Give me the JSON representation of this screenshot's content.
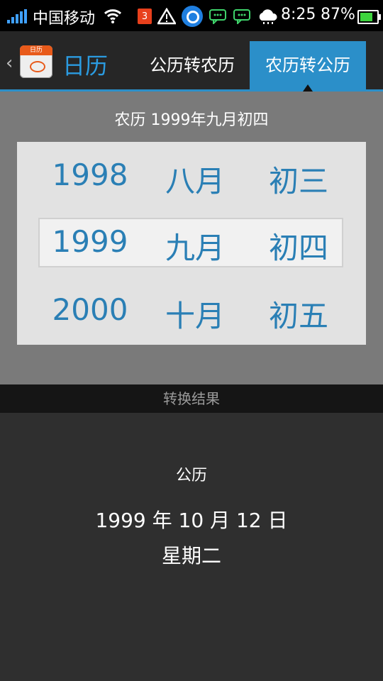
{
  "status_bar": {
    "carrier": "中国移动",
    "notification_count": "3",
    "time": "8:25",
    "battery": "87%",
    "battery_level": 0.87
  },
  "header": {
    "app_icon_label": "日历",
    "title": "日历",
    "tabs": [
      {
        "label": "公历转农历",
        "active": false
      },
      {
        "label": "农历转公历",
        "active": true
      }
    ]
  },
  "picker": {
    "title": "农历  1999年九月初四",
    "years": [
      "1998",
      "1999",
      "2000"
    ],
    "months": [
      "八月",
      "九月",
      "十月"
    ],
    "days": [
      "初三",
      "初四",
      "初五"
    ]
  },
  "result": {
    "header": "转换结果",
    "label": "公历",
    "date": "1999 年 10 月 12 日",
    "weekday": "星期二"
  },
  "colors": {
    "accent": "#2b8fc9",
    "picker_text": "#2a7fb5",
    "battery": "#3ed43e"
  }
}
